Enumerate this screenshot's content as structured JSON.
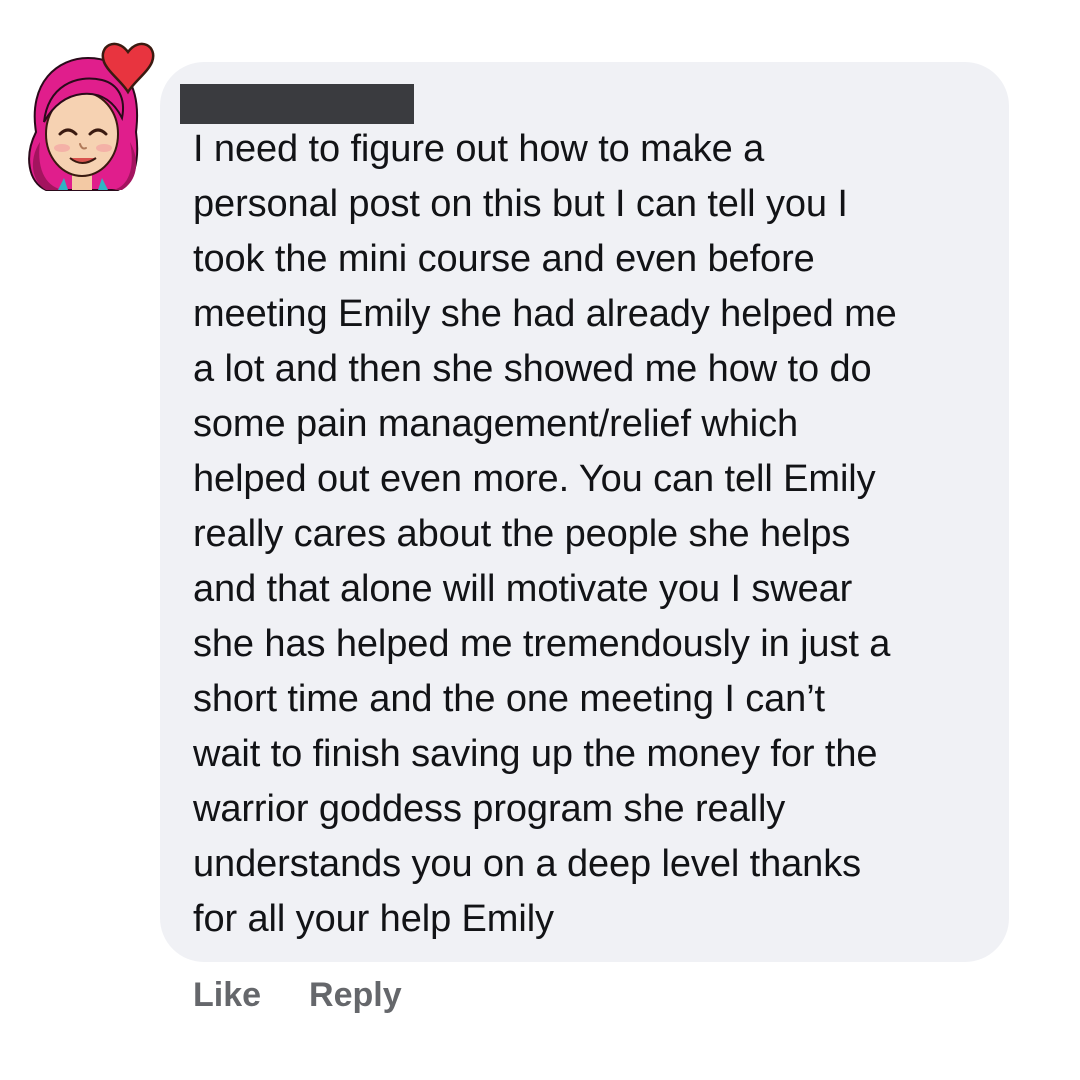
{
  "comment": {
    "author_redacted": true,
    "text": "I need to figure out how to make a\npersonal post on this but I can tell you I\ntook the mini course and even before\nmeeting Emily she had already helped me\na lot and then she showed me how to do\nsome pain management/relief which\nhelped out even more. You can tell Emily\nreally cares about the people she helps\nand that alone will motivate you I swear\nshe has helped me tremendously in just a\nshort time and the one meeting I can’t\nwait to finish saving up the money for the\nwarrior goddess program she really\nunderstands you on a deep level thanks\nfor all your help Emily"
  },
  "actions": {
    "like_label": "Like",
    "reply_label": "Reply"
  },
  "avatar": {
    "icon": "bitmoji-avatar-icon",
    "badge_icon": "heart-icon"
  },
  "colors": {
    "bubble_bg": "#f0f1f5",
    "text": "#121316",
    "action_text": "#65676b",
    "redaction": "#3a3b3f",
    "hair": "#e01e8c",
    "heart": "#e8343f"
  }
}
